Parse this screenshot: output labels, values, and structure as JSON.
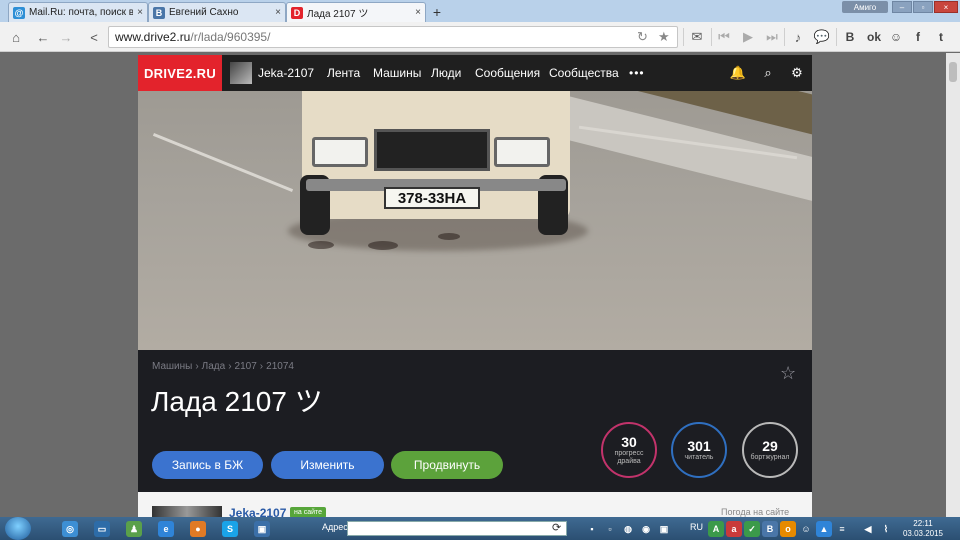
{
  "browser": {
    "tabs": [
      {
        "title": "Mail.Ru: почта, поиск в инт",
        "favicon": "mail-icon",
        "active": false
      },
      {
        "title": "Евгений Сахно",
        "favicon": "vk-icon",
        "active": false
      },
      {
        "title": "Лада 2107 ツ",
        "favicon": "drive2-icon",
        "active": true
      }
    ],
    "new_tab": "+",
    "app_badge": "Амиго",
    "url_host": "www.drive2.ru",
    "url_path": "/r/lada/960395/"
  },
  "site": {
    "logo": "DRIVE2.RU",
    "nav": {
      "user": "Jeka-2107",
      "feed": "Лента",
      "cars": "Машины",
      "people": "Люди",
      "messages": "Сообщения",
      "communities": "Сообщества",
      "more": "•••"
    }
  },
  "hero": {
    "plate": "378-33HA"
  },
  "car": {
    "breadcrumb": [
      "Машины",
      "›",
      "Лада",
      "›",
      "2107",
      "›",
      "21074"
    ],
    "title": "Лада 2107 ツ",
    "buttons": {
      "logbook": "Запись в БЖ",
      "edit": "Изменить",
      "promote": "Продвинуть"
    },
    "stats": [
      {
        "value": "30",
        "label": "прогресс драйва",
        "color": "#c2336b"
      },
      {
        "value": "301",
        "label": "читатель",
        "color": "#2f6fc0"
      },
      {
        "value": "29",
        "label": "бортжурнал",
        "color": "#b9b9b9"
      }
    ],
    "colors": {
      "button_blue": "#3b73cf",
      "button_green": "#5ca23b",
      "logo_red": "#e3232c"
    }
  },
  "bottom": {
    "username": "Jeka-2107",
    "online": "на сайте",
    "weather": "Погода на сайте"
  },
  "taskbar": {
    "address_label": "Адрес",
    "lang": "RU",
    "time": "22:11",
    "date": "03.03.2015"
  }
}
